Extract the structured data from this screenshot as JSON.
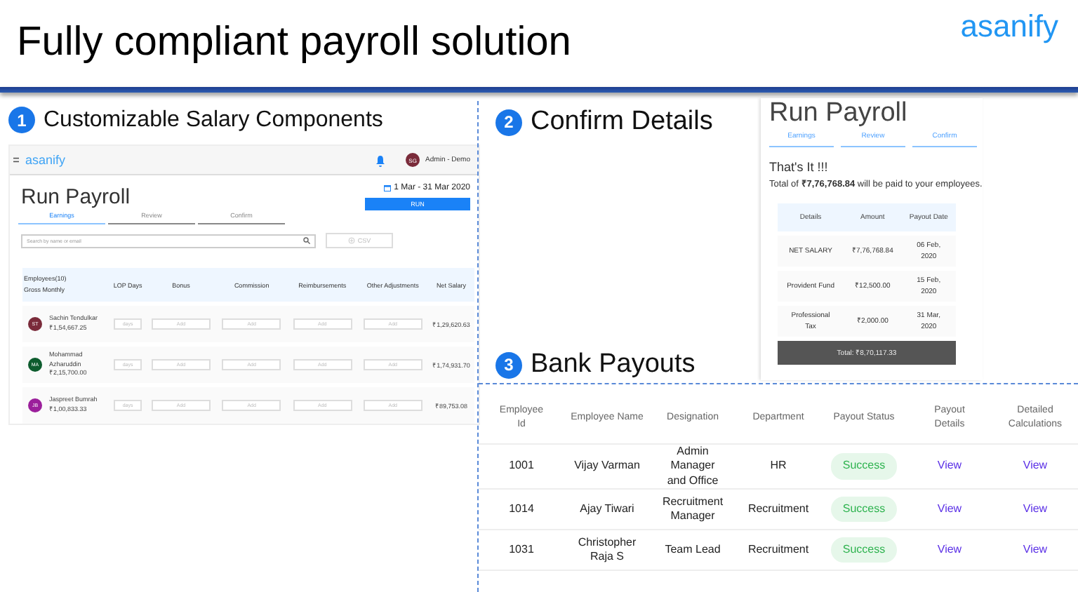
{
  "title": "Fully compliant payroll solution",
  "logo": "asanify",
  "sections": [
    {
      "number": "1",
      "title": "Customizable Salary Components"
    },
    {
      "number": "2",
      "title": "Confirm Details"
    },
    {
      "number": "3",
      "title": "Bank Payouts"
    }
  ],
  "salary_app": {
    "brand": "asanify",
    "user_initials": "SG",
    "user": "Admin - Demo",
    "page_title": "Run Payroll",
    "date_range": "1 Mar - 31 Mar 2020",
    "tabs": [
      {
        "label": "Earnings",
        "selected": true
      },
      {
        "label": "Review",
        "selected": false
      },
      {
        "label": "Confirm",
        "selected": false
      }
    ],
    "run_button": "RUN",
    "search": {
      "placeholder": "Search by name or email"
    },
    "csv_button": "CSV",
    "columns": [
      "Employees(10)\nGross Monthly",
      "LOP Days",
      "Bonus",
      "Commission",
      "Reimbursements",
      "Other Adjustments",
      "Net Salary"
    ],
    "rows": [
      {
        "initials": "ST",
        "color": "#7a2b3a",
        "name": "Sachin Tendulkar",
        "gross": "₹1,54,667.25",
        "days_placeholder": "days",
        "add_placeholders": [
          "Add",
          "Add",
          "Add",
          "Add"
        ],
        "net": "₹1,29,620.63"
      },
      {
        "initials": "MA",
        "color": "#0d5c2e",
        "name": "Mohammad\nAzharuddin",
        "gross": "₹2,15,700.00",
        "days_placeholder": "days",
        "add_placeholders": [
          "Add",
          "Add",
          "Add",
          "Add"
        ],
        "net": "₹1,74,931.70"
      },
      {
        "initials": "JB",
        "color": "#9b1f9b",
        "name": "Jaspreet Bumrah",
        "gross": "₹1,00,833.33",
        "days_placeholder": "days",
        "add_placeholders": [
          "Add",
          "Add",
          "Add",
          "Add"
        ],
        "net": "₹89,753.08"
      }
    ]
  },
  "confirm_app": {
    "page_title": "Run Payroll",
    "tabs": [
      {
        "label": "Earnings",
        "completed": true
      },
      {
        "label": "Review",
        "completed": true
      },
      {
        "label": "Confirm",
        "completed": true
      }
    ],
    "heading": "That's It !!!",
    "message": "Total of **₹7,76,768.84** will be paid to your employees.",
    "columns": [
      "Details",
      "Amount",
      "Payout Date"
    ],
    "rows": [
      [
        "NET SALARY",
        "₹7,76,768.84",
        "06 Feb,\n2020"
      ],
      [
        "Provident Fund",
        "₹12,500.00",
        "15 Feb,\n2020"
      ],
      [
        "Professional\nTax",
        "₹2,000.00",
        "31 Mar,\n2020"
      ]
    ],
    "total": "Total:  ₹8,70,117.33"
  },
  "payouts": {
    "columns": [
      "Employee\nId",
      "Employee Name",
      "Designation",
      "Department",
      "Payout Status",
      "Payout\nDetails",
      "Detailed\nCalculations"
    ],
    "rows": [
      {
        "id": "1001",
        "name": "Vijay Varman",
        "designation": "Admin\nManager\nand Office",
        "department": "HR",
        "status": "Success",
        "payout_link": "View",
        "calc_link": "View"
      },
      {
        "id": "1014",
        "name": "Ajay Tiwari",
        "designation": "Recruitment\nManager",
        "department": "Recruitment",
        "status": "Success",
        "payout_link": "View",
        "calc_link": "View"
      },
      {
        "id": "1031",
        "name": "Christopher\nRaja S",
        "designation": "Team Lead",
        "department": "Recruitment",
        "status": "Success",
        "payout_link": "View",
        "calc_link": "View"
      }
    ]
  }
}
